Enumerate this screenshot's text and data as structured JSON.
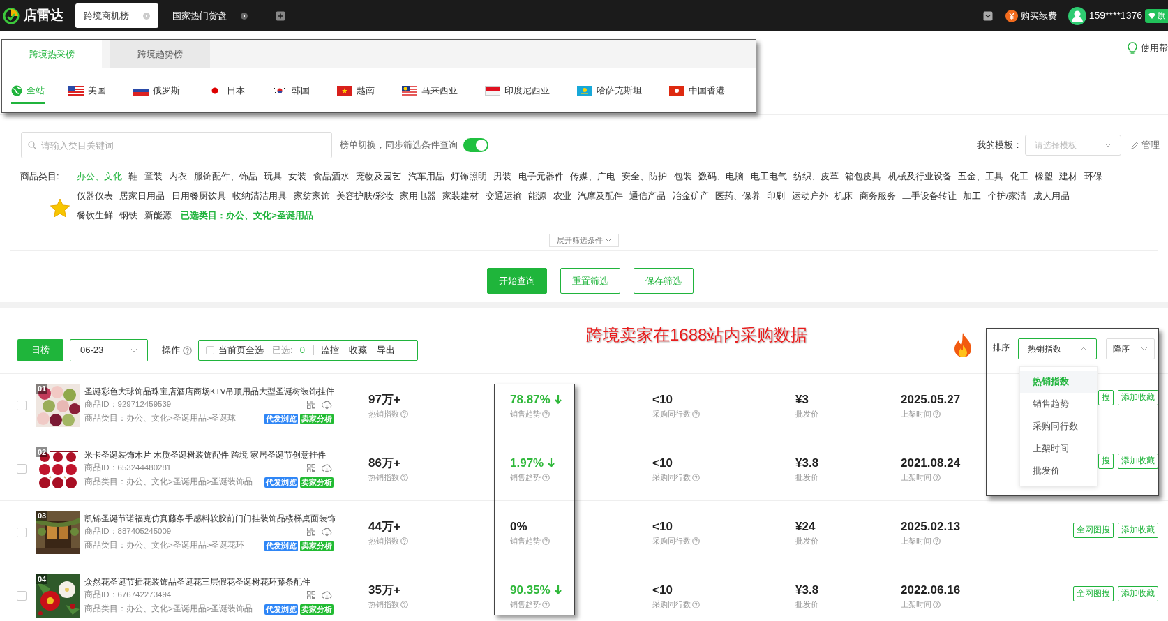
{
  "top_bar": {
    "logo": "店雷达",
    "tabs": [
      {
        "label": "跨境商机榜",
        "selected": true
      },
      {
        "label": "国家热门货盘",
        "selected": false
      }
    ],
    "purchase": "购买续费",
    "user": "159****1376",
    "badge": "旗"
  },
  "panel_tabs": [
    {
      "label": "跨境热采榜",
      "selected": true
    },
    {
      "label": "跨境趋势榜",
      "selected": false
    }
  ],
  "countries": [
    {
      "label": "全站",
      "selected": true
    },
    {
      "label": "美国",
      "selected": false
    },
    {
      "label": "俄罗斯",
      "selected": false
    },
    {
      "label": "日本",
      "selected": false
    },
    {
      "label": "韩国",
      "selected": false
    },
    {
      "label": "越南",
      "selected": false
    },
    {
      "label": "马来西亚",
      "selected": false
    },
    {
      "label": "印度尼西亚",
      "selected": false
    },
    {
      "label": "哈萨克斯坦",
      "selected": false
    },
    {
      "label": "中国香港",
      "selected": false
    }
  ],
  "help": "使用帮",
  "search": {
    "placeholder": "请输入类目关键词"
  },
  "sync_toggle": {
    "label": "榜单切换，同步筛选条件查询",
    "on": true
  },
  "template": {
    "label": "我的模板：",
    "placeholder": "请选择模板",
    "manage": "管理"
  },
  "category_label": "商品类目:",
  "category_lines": [
    {
      "items": [
        {
          "label": "办公、文化",
          "selected": true
        },
        {
          "label": "鞋",
          "selected": false
        },
        {
          "label": "童装",
          "selected": false
        },
        {
          "label": "内衣",
          "selected": false
        },
        {
          "label": "服饰配件、饰品",
          "selected": false
        },
        {
          "label": "玩具",
          "selected": false
        },
        {
          "label": "女装",
          "selected": false
        },
        {
          "label": "食品酒水",
          "selected": false
        },
        {
          "label": "宠物及园艺",
          "selected": false
        },
        {
          "label": "汽车用品",
          "selected": false
        },
        {
          "label": "灯饰照明",
          "selected": false
        },
        {
          "label": "男装",
          "selected": false
        },
        {
          "label": "电子元器件",
          "selected": false
        },
        {
          "label": "传媒、广电",
          "selected": false
        },
        {
          "label": "安全、防护",
          "selected": false
        },
        {
          "label": "包装",
          "selected": false
        },
        {
          "label": "数码、电脑",
          "selected": false
        },
        {
          "label": "电工电气",
          "selected": false
        },
        {
          "label": "纺织、皮革",
          "selected": false
        },
        {
          "label": "箱包皮具",
          "selected": false
        },
        {
          "label": "机械及行业设备",
          "selected": false
        },
        {
          "label": "五金、工具",
          "selected": false
        },
        {
          "label": "化工",
          "selected": false
        },
        {
          "label": "橡塑",
          "selected": false
        },
        {
          "label": "建材",
          "selected": false
        },
        {
          "label": "环保",
          "selected": false
        }
      ]
    },
    {
      "items": [
        {
          "label": "仪器仪表",
          "selected": false
        },
        {
          "label": "居家日用品",
          "selected": false
        },
        {
          "label": "日用餐厨饮具",
          "selected": false
        },
        {
          "label": "收纳清洁用具",
          "selected": false
        },
        {
          "label": "家纺家饰",
          "selected": false
        },
        {
          "label": "美容护肤/彩妆",
          "selected": false
        },
        {
          "label": "家用电器",
          "selected": false
        },
        {
          "label": "家装建材",
          "selected": false
        },
        {
          "label": "交通运输",
          "selected": false
        },
        {
          "label": "能源",
          "selected": false
        },
        {
          "label": "农业",
          "selected": false
        },
        {
          "label": "汽摩及配件",
          "selected": false
        },
        {
          "label": "通信产品",
          "selected": false
        },
        {
          "label": "冶金矿产",
          "selected": false
        },
        {
          "label": "医药、保养",
          "selected": false
        },
        {
          "label": "印刷",
          "selected": false
        },
        {
          "label": "运动户外",
          "selected": false
        },
        {
          "label": "机床",
          "selected": false
        },
        {
          "label": "商务服务",
          "selected": false
        },
        {
          "label": "二手设备转让",
          "selected": false
        },
        {
          "label": "加工",
          "selected": false
        },
        {
          "label": "个护/家清",
          "selected": false
        },
        {
          "label": "成人用品",
          "selected": false
        }
      ]
    },
    {
      "items": [
        {
          "label": "餐饮生鲜",
          "selected": false
        },
        {
          "label": "钢铁",
          "selected": false
        },
        {
          "label": "新能源",
          "selected": false
        }
      ]
    }
  ],
  "selected_category": "已选类目：办公、文化>圣诞用品",
  "expand": "展开筛选条件",
  "buttons": [
    {
      "label": "开始查询",
      "kind": "primary"
    },
    {
      "label": "重置筛选",
      "kind": "outline"
    },
    {
      "label": "保存筛选",
      "kind": "outline"
    }
  ],
  "toolbar": {
    "period": "日榜",
    "date": "06-23",
    "ops_label": "操作",
    "select_all": {
      "label": "当前页全选",
      "checked": false
    },
    "selected_label": "已选:",
    "selected_count": "0",
    "actions": [
      "监控",
      "收藏",
      "导出"
    ]
  },
  "annotation": "跨境卖家在1688站内采购数据",
  "sort": {
    "label": "排序",
    "field": "热销指数",
    "order": "降序",
    "options": [
      {
        "label": "热销指数",
        "selected": true
      },
      {
        "label": "销售趋势",
        "selected": false
      },
      {
        "label": "采购同行数",
        "selected": false
      },
      {
        "label": "上架时间",
        "selected": false
      },
      {
        "label": "批发价",
        "selected": false
      }
    ]
  },
  "rows": [
    {
      "rank": "01",
      "checked": false,
      "title": "圣诞彩色大球饰品珠宝店酒店商场KTV吊顶用品大型圣诞树装饰挂件",
      "id": "商品ID：929712459539",
      "category": "商品类目：办公、文化>圣诞用品>圣诞球",
      "tags": [
        "代发浏览",
        "卖家分析"
      ],
      "hot": "97万+",
      "hot_label": "热销指数",
      "trend": "78.87%",
      "trend_down": true,
      "trend_label": "销售趋势",
      "peers": "<10",
      "peers_label": "采购同行数",
      "price": "¥3",
      "price_label": "批发价",
      "date": "2025.05.27",
      "date_label": "上架时间",
      "actions": [
        "搜",
        "添加收藏"
      ]
    },
    {
      "rank": "02",
      "checked": false,
      "title": "米卡圣诞装饰木片 木质圣诞树装饰配件 跨境 家居圣诞节创意挂件",
      "id": "商品ID：653244480281",
      "category": "商品类目：办公、文化>圣诞用品>圣诞装饰品",
      "tags": [
        "代发浏览",
        "卖家分析"
      ],
      "hot": "86万+",
      "hot_label": "热销指数",
      "trend": "1.97%",
      "trend_down": true,
      "trend_label": "销售趋势",
      "peers": "<10",
      "peers_label": "采购同行数",
      "price": "¥3.8",
      "price_label": "批发价",
      "date": "2021.08.24",
      "date_label": "上架时间",
      "actions": [
        "搜",
        "添加收藏"
      ]
    },
    {
      "rank": "03",
      "checked": false,
      "title": "凯锦圣诞节诺福克仿真藤条手感料软胶前门门挂装饰品楼梯桌面装饰",
      "id": "商品ID：887405245009",
      "category": "商品类目：办公、文化>圣诞用品>圣诞花环",
      "tags": [
        "代发浏览",
        "卖家分析"
      ],
      "hot": "44万+",
      "hot_label": "热销指数",
      "trend": "0%",
      "trend_down": false,
      "trend_label": "销售趋势",
      "peers": "<10",
      "peers_label": "采购同行数",
      "price": "¥24",
      "price_label": "批发价",
      "date": "2025.02.13",
      "date_label": "上架时间",
      "actions": [
        "全网图搜",
        "添加收藏"
      ]
    },
    {
      "rank": "04",
      "checked": false,
      "title": "众然花圣诞节插花装饰品圣诞花三层假花圣诞树花环藤条配件",
      "id": "商品ID：676742273494",
      "category": "商品类目：办公、文化>圣诞用品>圣诞装饰品",
      "tags": [
        "代发浏览",
        "卖家分析"
      ],
      "hot": "35万+",
      "hot_label": "热销指数",
      "trend": "90.35%",
      "trend_down": true,
      "trend_label": "销售趋势",
      "peers": "<10",
      "peers_label": "采购同行数",
      "price": "¥3.8",
      "price_label": "批发价",
      "date": "2022.06.16",
      "date_label": "上架时间",
      "actions": [
        "全网图搜",
        "添加收藏"
      ]
    }
  ]
}
